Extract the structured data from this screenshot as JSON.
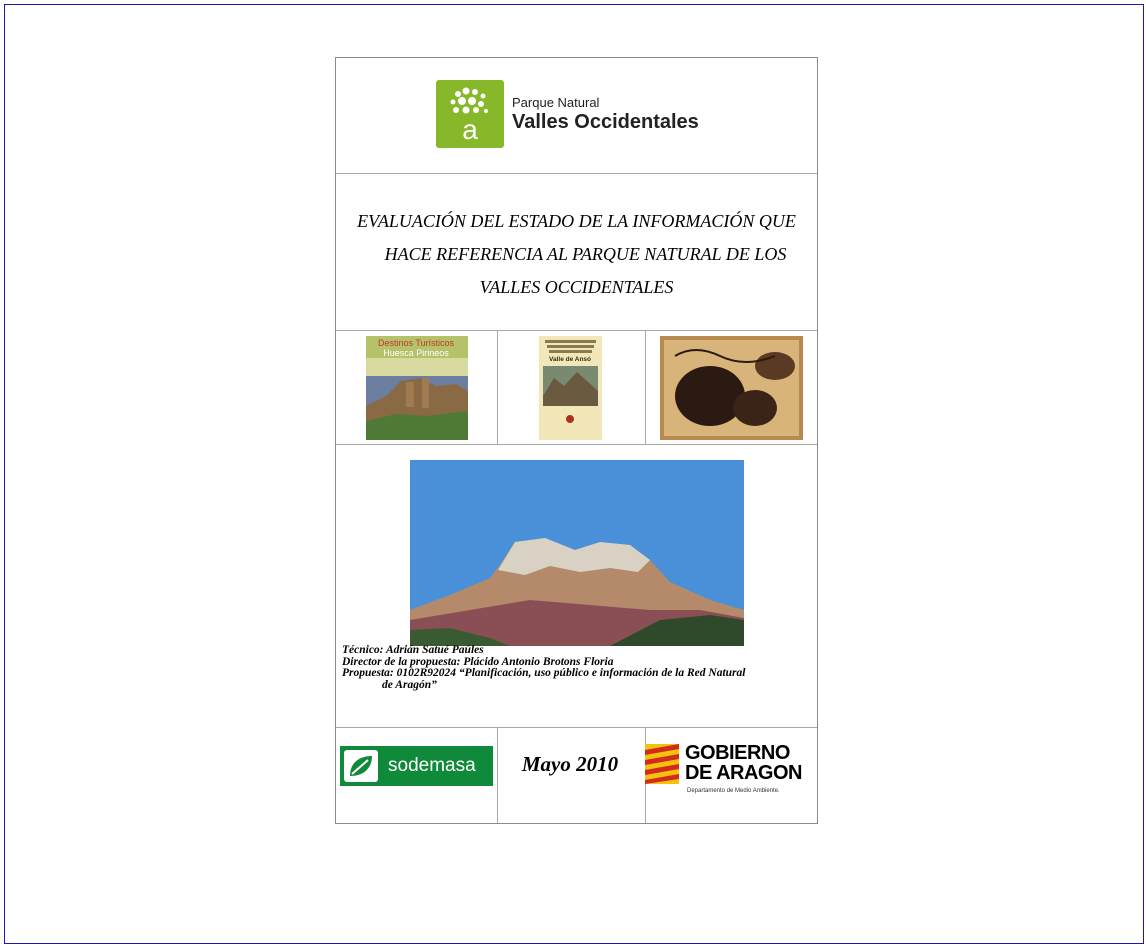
{
  "header": {
    "logo_letter": "a",
    "park_line1": "Parque  Natural",
    "park_line2": "Valles Occidentales"
  },
  "title": {
    "line1": "EVALUACIÓN DEL ESTADO DE LA INFORMACIÓN QUE",
    "line2": "HACE REFERENCIA AL  PARQUE NATURAL DE LOS",
    "line3": "VALLES OCCIDENTALES"
  },
  "thumbnails": {
    "t1_line1": "Destinos Turísticos",
    "t1_line2": "Huesca Pirineos",
    "t2_title": "Valle de Ansó"
  },
  "credits": {
    "tecnico": "Técnico: Adrián Satué Paúles",
    "director": "Director de la propuesta: Plácido Antonio Brotons Floria",
    "propuesta_line1": "Propuesta: 0102R92024 “Planificación, uso público e información de la Red Natural",
    "propuesta_line2": "de Aragón”"
  },
  "footer": {
    "sodemasa": "sodemasa",
    "date": "Mayo 2010",
    "gob_line1": "GOBIERNO",
    "gob_line2": "DE ARAGON",
    "department": "Departamento de Medio Ambiente."
  },
  "colors": {
    "frame_border": "#1a1aa8",
    "logo_green": "#86b829",
    "sodemasa_green": "#0f8a3a",
    "sky": "#4a90d9"
  }
}
